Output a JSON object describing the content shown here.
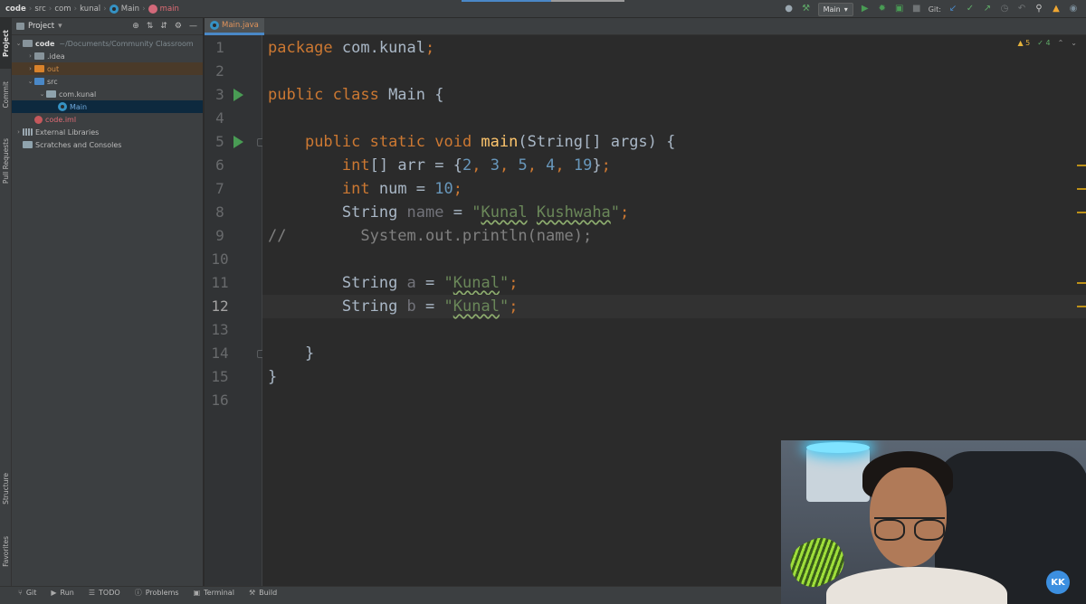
{
  "navbar": {
    "breadcrumbs": [
      {
        "label": "code",
        "kind": "root"
      },
      {
        "label": "src",
        "kind": "folder"
      },
      {
        "label": "com",
        "kind": "folder"
      },
      {
        "label": "kunal",
        "kind": "folder"
      },
      {
        "label": "Main",
        "kind": "class"
      },
      {
        "label": "main",
        "kind": "method"
      }
    ],
    "run_config": "Main",
    "git_label": "Git:",
    "progress": 0.55
  },
  "tool_stripe": {
    "project_tab": "Project",
    "commit_tab": "Commit",
    "pull_requests_tab": "Pull Requests",
    "structure_tab": "Structure",
    "favorites_tab": "Favorites"
  },
  "project_panel": {
    "title": "Project",
    "tree": [
      {
        "label": "code",
        "path": "~/Documents/Community Classroom",
        "depth": 0,
        "expanded": true,
        "icon": "folder",
        "style": "bold"
      },
      {
        "label": ".idea",
        "depth": 1,
        "expanded": false,
        "icon": "folder",
        "style": "normal"
      },
      {
        "label": "out",
        "depth": 1,
        "expanded": false,
        "icon": "folder-orange",
        "style": "orange"
      },
      {
        "label": "src",
        "depth": 1,
        "expanded": true,
        "icon": "folder-src",
        "style": "normal"
      },
      {
        "label": "com.kunal",
        "depth": 2,
        "expanded": true,
        "icon": "package",
        "style": "normal"
      },
      {
        "label": "Main",
        "depth": 3,
        "icon": "class",
        "style": "red",
        "selected": true
      },
      {
        "label": "code.iml",
        "depth": 1,
        "icon": "iml",
        "style": "red"
      },
      {
        "label": "External Libraries",
        "depth": 0,
        "expanded": false,
        "icon": "libraries",
        "style": "normal"
      },
      {
        "label": "Scratches and Consoles",
        "depth": 0,
        "icon": "scratch",
        "style": "normal"
      }
    ]
  },
  "editor": {
    "tab_label": "Main.java",
    "inspections": {
      "warnings": "5",
      "weak_warnings": "4"
    },
    "current_line": 12,
    "lines": [
      {
        "n": "1",
        "tokens": [
          {
            "t": "package ",
            "c": "kw"
          },
          {
            "t": "com.kunal",
            "c": ""
          },
          {
            "t": ";",
            "c": "kw"
          }
        ]
      },
      {
        "n": "2",
        "tokens": []
      },
      {
        "n": "3",
        "run": true,
        "tokens": [
          {
            "t": "public class ",
            "c": "kw"
          },
          {
            "t": "Main {",
            "c": ""
          }
        ]
      },
      {
        "n": "4",
        "tokens": []
      },
      {
        "n": "5",
        "run": true,
        "fold": true,
        "tokens": [
          {
            "t": "    "
          },
          {
            "t": "public static void ",
            "c": "kw"
          },
          {
            "t": "main",
            "c": "fn"
          },
          {
            "t": "(String[] args) {",
            "c": ""
          }
        ]
      },
      {
        "n": "6",
        "tokens": [
          {
            "t": "        "
          },
          {
            "t": "int",
            "c": "kw"
          },
          {
            "t": "[] arr = {",
            "c": ""
          },
          {
            "t": "2",
            "c": "num2"
          },
          {
            "t": ", ",
            "c": "kw"
          },
          {
            "t": "3",
            "c": "num2"
          },
          {
            "t": ", ",
            "c": "kw"
          },
          {
            "t": "5",
            "c": "num2"
          },
          {
            "t": ", ",
            "c": "kw"
          },
          {
            "t": "4",
            "c": "num2"
          },
          {
            "t": ", ",
            "c": "kw"
          },
          {
            "t": "19",
            "c": "num2"
          },
          {
            "t": "}",
            "c": ""
          },
          {
            "t": ";",
            "c": "kw"
          }
        ]
      },
      {
        "n": "7",
        "tokens": [
          {
            "t": "        "
          },
          {
            "t": "int ",
            "c": "kw"
          },
          {
            "t": "num = ",
            "c": ""
          },
          {
            "t": "10",
            "c": "num2"
          },
          {
            "t": ";",
            "c": "kw"
          }
        ]
      },
      {
        "n": "8",
        "tokens": [
          {
            "t": "        "
          },
          {
            "t": "String ",
            "c": ""
          },
          {
            "t": "name",
            "c": "unused"
          },
          {
            "t": " = ",
            "c": ""
          },
          {
            "t": "\"",
            "c": "str"
          },
          {
            "t": "Kunal",
            "c": "str typo"
          },
          {
            "t": " ",
            "c": "str"
          },
          {
            "t": "Kushwaha",
            "c": "str typo"
          },
          {
            "t": "\"",
            "c": "str"
          },
          {
            "t": ";",
            "c": "kw"
          }
        ]
      },
      {
        "n": "9",
        "tokens": [
          {
            "t": "//        System.out.println(name);",
            "c": "cmt"
          }
        ]
      },
      {
        "n": "10",
        "tokens": []
      },
      {
        "n": "11",
        "tokens": [
          {
            "t": "        "
          },
          {
            "t": "String ",
            "c": ""
          },
          {
            "t": "a",
            "c": "unused"
          },
          {
            "t": " = ",
            "c": ""
          },
          {
            "t": "\"",
            "c": "str"
          },
          {
            "t": "Kunal",
            "c": "str typo"
          },
          {
            "t": "\"",
            "c": "str"
          },
          {
            "t": ";",
            "c": "kw"
          }
        ]
      },
      {
        "n": "12",
        "tokens": [
          {
            "t": "        "
          },
          {
            "t": "String ",
            "c": ""
          },
          {
            "t": "b",
            "c": "unused"
          },
          {
            "t": " = ",
            "c": ""
          },
          {
            "t": "\"",
            "c": "str"
          },
          {
            "t": "Kunal",
            "c": "str typo"
          },
          {
            "t": "\"",
            "c": "str"
          },
          {
            "t": ";",
            "c": "kw"
          }
        ]
      },
      {
        "n": "13",
        "tokens": []
      },
      {
        "n": "14",
        "fold": true,
        "tokens": [
          {
            "t": "    "
          },
          {
            "t": "}",
            "c": ""
          }
        ]
      },
      {
        "n": "15",
        "tokens": [
          {
            "t": "}",
            "c": ""
          }
        ]
      },
      {
        "n": "16",
        "tokens": []
      }
    ]
  },
  "bottom_tools": [
    {
      "label": "Git",
      "icon": "git-branch-icon"
    },
    {
      "label": "Run",
      "icon": "run-icon"
    },
    {
      "label": "TODO",
      "icon": "todo-list-icon"
    },
    {
      "label": "Problems",
      "icon": "problems-icon"
    },
    {
      "label": "Terminal",
      "icon": "terminal-icon"
    },
    {
      "label": "Build",
      "icon": "build-hammer-icon"
    }
  ],
  "webcam": {
    "logo_text": "KK"
  },
  "colors": {
    "background": "#2b2b2b",
    "panel": "#3c3f41",
    "keyword": "#cc7832",
    "string": "#6a8759",
    "number": "#6897bb",
    "method": "#ffc66d",
    "run_green": "#499c54",
    "accent_blue": "#4a88c7"
  }
}
